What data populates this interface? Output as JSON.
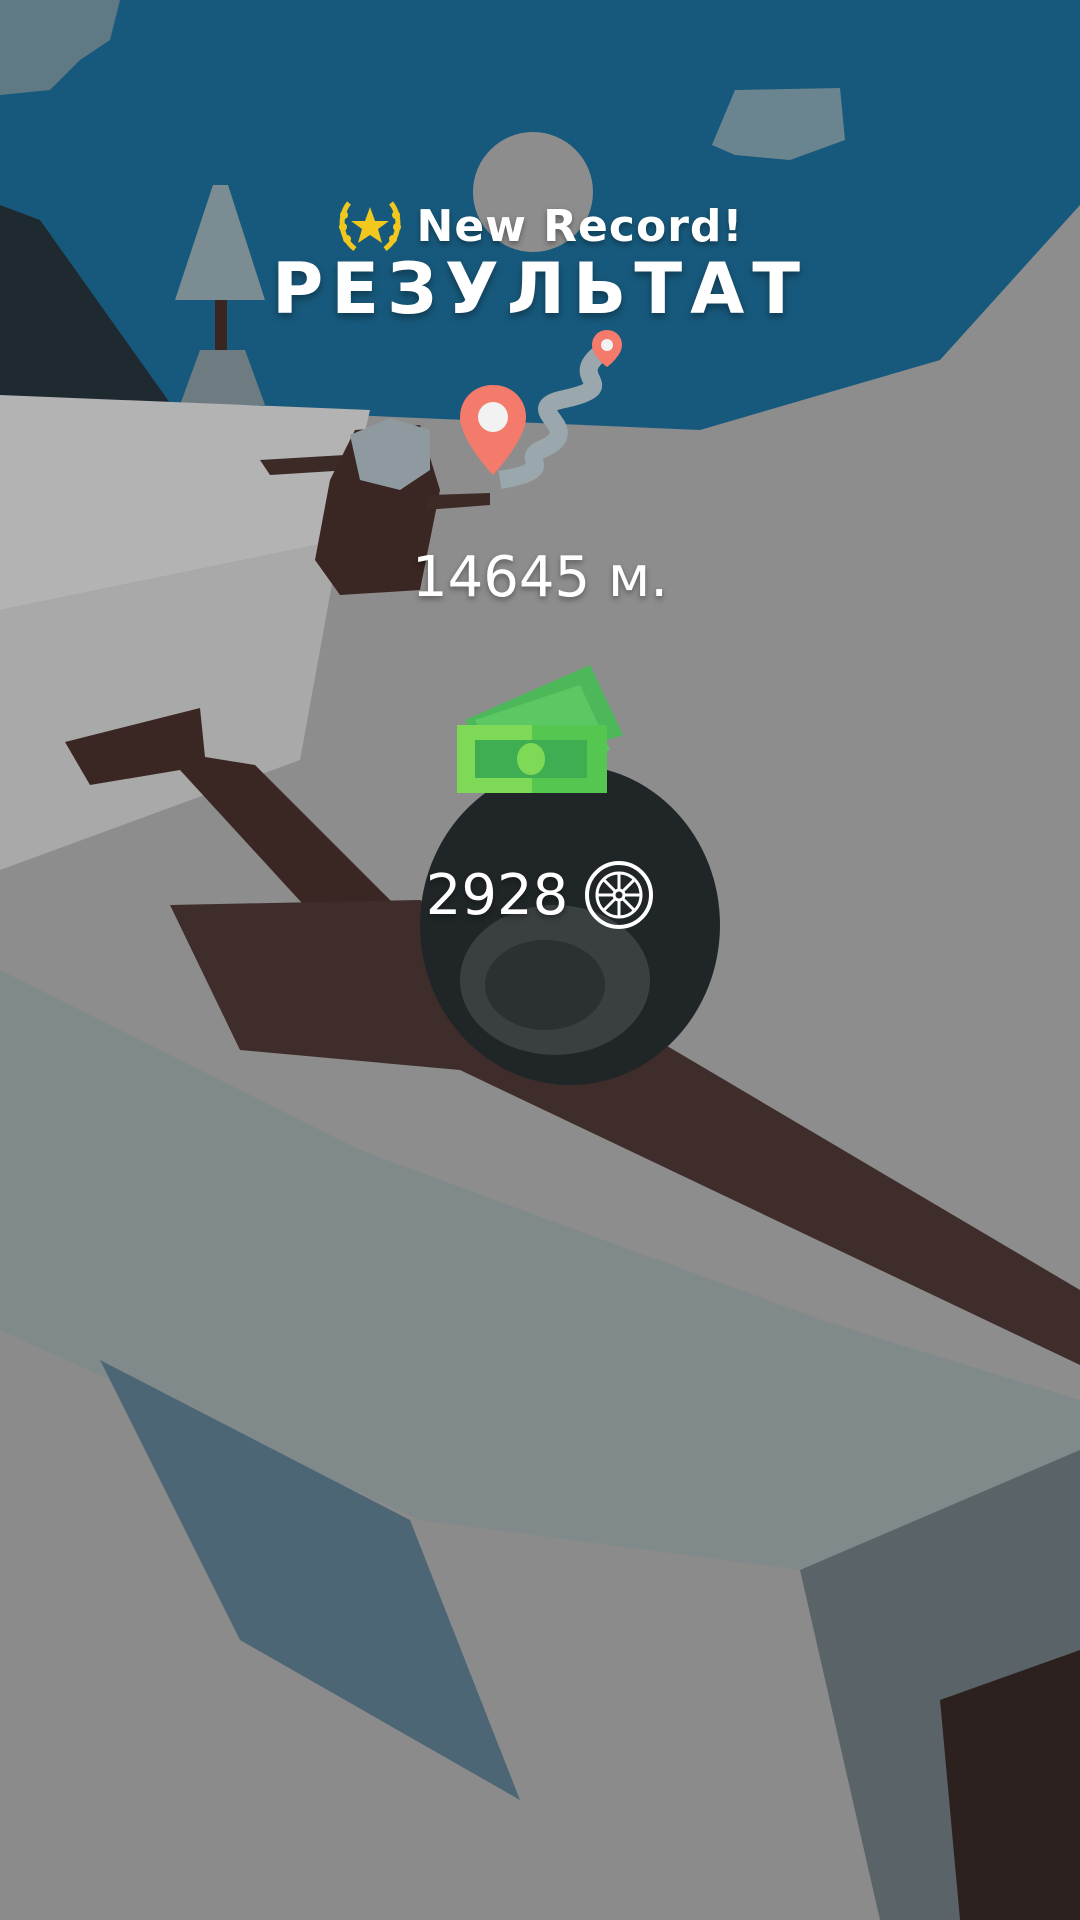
{
  "result": {
    "new_record_label": "New Record!",
    "title": "РЕЗУЛЬТАТ",
    "distance": "14645 м.",
    "coins": "2928"
  },
  "icons": {
    "record": "laurel-star-icon",
    "route": "route-pins-icon",
    "money": "banknotes-icon",
    "currency": "wheel-icon"
  },
  "colors": {
    "sky": "#17597c",
    "snow": "#8e8e8e",
    "pin": "#f47a6b",
    "money_green": "#6cc850",
    "laurel": "#f2c81e",
    "text": "#ffffff"
  }
}
